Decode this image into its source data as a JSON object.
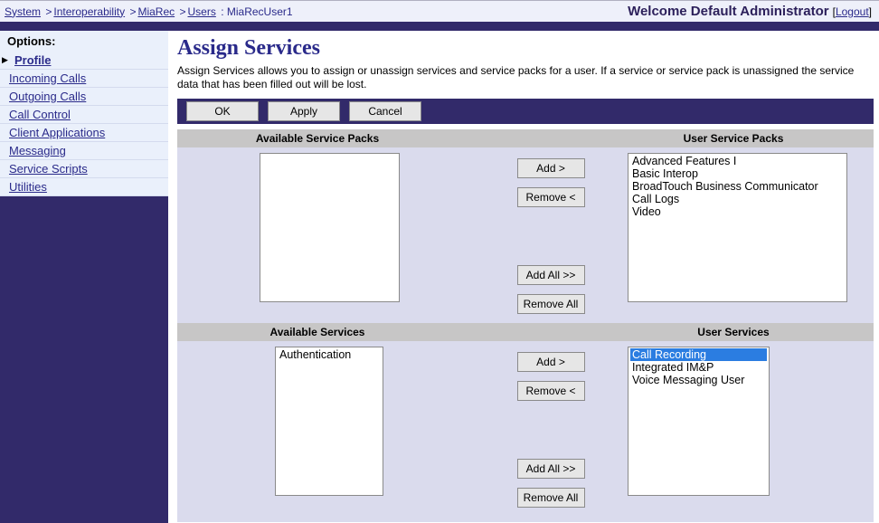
{
  "breadcrumb": {
    "system": "System",
    "interoperability": "Interoperability",
    "miarec": "MiaRec",
    "users": "Users",
    "current": "MiaRecUser1",
    "sep": ">"
  },
  "header": {
    "welcome": "Welcome Default Administrator",
    "logout": "Logout"
  },
  "sidebar": {
    "title": "Options:",
    "items": [
      {
        "label": "Profile",
        "active": true
      },
      {
        "label": "Incoming Calls"
      },
      {
        "label": "Outgoing Calls"
      },
      {
        "label": "Call Control"
      },
      {
        "label": "Client Applications"
      },
      {
        "label": "Messaging"
      },
      {
        "label": "Service Scripts"
      },
      {
        "label": "Utilities"
      }
    ]
  },
  "page": {
    "title": "Assign Services",
    "description": "Assign Services allows you to assign or unassign services and service packs for a user. If a service or service pack is unassigned the service data that has been filled out will be lost."
  },
  "buttons": {
    "ok": "OK",
    "apply": "Apply",
    "cancel": "Cancel",
    "add": "Add >",
    "remove": "Remove <",
    "addAll": "Add All >>",
    "removeAll": "Remove All"
  },
  "sections": {
    "servicePacks": {
      "leftHeader": "Available Service Packs",
      "rightHeader": "User Service Packs",
      "available": [],
      "user": [
        "Advanced Features I",
        "Basic Interop",
        "BroadTouch Business Communicator",
        "Call Logs",
        "Video"
      ]
    },
    "services": {
      "leftHeader": "Available Services",
      "rightHeader": "User Services",
      "available": [
        "Authentication"
      ],
      "user": [
        {
          "label": "Call Recording",
          "selected": true
        },
        {
          "label": "Integrated IM&P"
        },
        {
          "label": "Voice Messaging User"
        }
      ]
    }
  }
}
